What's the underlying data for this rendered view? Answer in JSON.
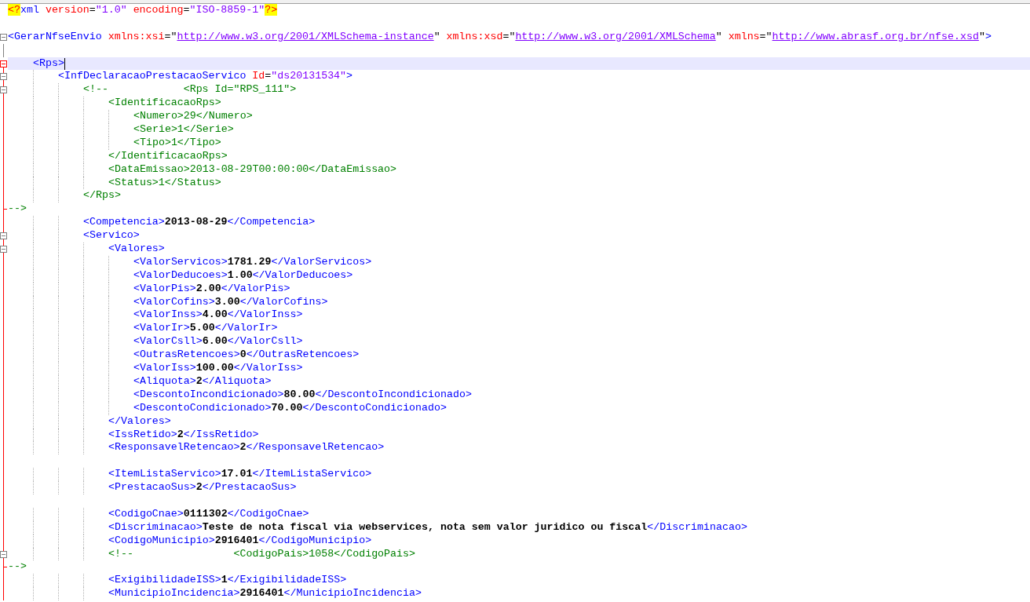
{
  "editor": {
    "lines": [
      {
        "kind": "code",
        "parts": [
          {
            "kind": "decl",
            "text": "<?"
          },
          {
            "kind": "tag",
            "text": "xml"
          },
          {
            "kind": "attr",
            "text": " version"
          },
          {
            "kind": "plain",
            "text": "="
          },
          {
            "kind": "val",
            "text": "\"1.0\""
          },
          {
            "kind": "attr",
            "text": " encoding"
          },
          {
            "kind": "plain",
            "text": "="
          },
          {
            "kind": "val",
            "text": "\"ISO-8859-1\""
          },
          {
            "kind": "decl",
            "text": "?>"
          }
        ]
      },
      {
        "kind": "blank"
      },
      {
        "kind": "code",
        "collapsible": true,
        "parts": [
          {
            "kind": "tag",
            "text": "<GerarNfseEnvio"
          },
          {
            "kind": "attr",
            "text": " xmlns:xsi"
          },
          {
            "kind": "plain",
            "text": "=\""
          },
          {
            "kind": "url",
            "text": "http://www.w3.org/2001/XMLSchema-instance"
          },
          {
            "kind": "plain",
            "text": "\""
          },
          {
            "kind": "attr",
            "text": " xmlns:xsd"
          },
          {
            "kind": "plain",
            "text": "=\""
          },
          {
            "kind": "url",
            "text": "http://www.w3.org/2001/XMLSchema"
          },
          {
            "kind": "plain",
            "text": "\""
          },
          {
            "kind": "attr",
            "text": " xmlns"
          },
          {
            "kind": "plain",
            "text": "=\""
          },
          {
            "kind": "url",
            "text": "http://www.abrasf.org.br/nfse.xsd"
          },
          {
            "kind": "plain",
            "text": "\""
          },
          {
            "kind": "tag",
            "text": ">"
          }
        ]
      },
      {
        "kind": "blank"
      },
      {
        "kind": "code",
        "collapsible": true,
        "current": true,
        "parts": [
          {
            "kind": "tag",
            "text": "    <Rps>"
          }
        ]
      },
      {
        "kind": "code",
        "collapsible": true,
        "parts": [
          {
            "kind": "tag",
            "text": "        <InfDeclaracaoPrestacaoServico"
          },
          {
            "kind": "attr",
            "text": " Id"
          },
          {
            "kind": "plain",
            "text": "="
          },
          {
            "kind": "val",
            "text": "\"ds20131534\""
          },
          {
            "kind": "tag",
            "text": ">"
          }
        ]
      },
      {
        "kind": "code",
        "collapsible": true,
        "parts": [
          {
            "kind": "comment",
            "text": "            <!--            <Rps Id=\"RPS_111\">"
          }
        ]
      },
      {
        "kind": "code",
        "parts": [
          {
            "kind": "comment",
            "text": "                <IdentificacaoRps>"
          }
        ]
      },
      {
        "kind": "code",
        "parts": [
          {
            "kind": "comment",
            "text": "                    <Numero>29</Numero>"
          }
        ]
      },
      {
        "kind": "code",
        "parts": [
          {
            "kind": "comment",
            "text": "                    <Serie>1</Serie>"
          }
        ]
      },
      {
        "kind": "code",
        "parts": [
          {
            "kind": "comment",
            "text": "                    <Tipo>1</Tipo>"
          }
        ]
      },
      {
        "kind": "code",
        "parts": [
          {
            "kind": "comment",
            "text": "                </IdentificacaoRps>"
          }
        ]
      },
      {
        "kind": "code",
        "parts": [
          {
            "kind": "comment",
            "text": "                <DataEmissao>2013-08-29T00:00:00</DataEmissao>"
          }
        ]
      },
      {
        "kind": "code",
        "parts": [
          {
            "kind": "comment",
            "text": "                <Status>1</Status>"
          }
        ]
      },
      {
        "kind": "code",
        "parts": [
          {
            "kind": "comment",
            "text": "            </Rps>"
          }
        ]
      },
      {
        "kind": "code",
        "block_end": true,
        "parts": [
          {
            "kind": "comment",
            "text": "-->"
          }
        ]
      },
      {
        "kind": "code",
        "parts": [
          {
            "kind": "tag",
            "text": "            <Competencia>"
          },
          {
            "kind": "text",
            "text": "2013-08-29"
          },
          {
            "kind": "tag",
            "text": "</Competencia>"
          }
        ]
      },
      {
        "kind": "code",
        "collapsible": true,
        "parts": [
          {
            "kind": "tag",
            "text": "            <Servico>"
          }
        ]
      },
      {
        "kind": "code",
        "collapsible": true,
        "parts": [
          {
            "kind": "tag",
            "text": "                <Valores>"
          }
        ]
      },
      {
        "kind": "code",
        "parts": [
          {
            "kind": "tag",
            "text": "                    <ValorServicos>"
          },
          {
            "kind": "text",
            "text": "1781.29"
          },
          {
            "kind": "tag",
            "text": "</ValorServicos>"
          }
        ]
      },
      {
        "kind": "code",
        "parts": [
          {
            "kind": "tag",
            "text": "                    <ValorDeducoes>"
          },
          {
            "kind": "text",
            "text": "1.00"
          },
          {
            "kind": "tag",
            "text": "</ValorDeducoes>"
          }
        ]
      },
      {
        "kind": "code",
        "parts": [
          {
            "kind": "tag",
            "text": "                    <ValorPis>"
          },
          {
            "kind": "text",
            "text": "2.00"
          },
          {
            "kind": "tag",
            "text": "</ValorPis>"
          }
        ]
      },
      {
        "kind": "code",
        "parts": [
          {
            "kind": "tag",
            "text": "                    <ValorCofins>"
          },
          {
            "kind": "text",
            "text": "3.00"
          },
          {
            "kind": "tag",
            "text": "</ValorCofins>"
          }
        ]
      },
      {
        "kind": "code",
        "parts": [
          {
            "kind": "tag",
            "text": "                    <ValorInss>"
          },
          {
            "kind": "text",
            "text": "4.00"
          },
          {
            "kind": "tag",
            "text": "</ValorInss>"
          }
        ]
      },
      {
        "kind": "code",
        "parts": [
          {
            "kind": "tag",
            "text": "                    <ValorIr>"
          },
          {
            "kind": "text",
            "text": "5.00"
          },
          {
            "kind": "tag",
            "text": "</ValorIr>"
          }
        ]
      },
      {
        "kind": "code",
        "parts": [
          {
            "kind": "tag",
            "text": "                    <ValorCsll>"
          },
          {
            "kind": "text",
            "text": "6.00"
          },
          {
            "kind": "tag",
            "text": "</ValorCsll>"
          }
        ]
      },
      {
        "kind": "code",
        "parts": [
          {
            "kind": "tag",
            "text": "                    <OutrasRetencoes>"
          },
          {
            "kind": "text",
            "text": "0"
          },
          {
            "kind": "tag",
            "text": "</OutrasRetencoes>"
          }
        ]
      },
      {
        "kind": "code",
        "parts": [
          {
            "kind": "tag",
            "text": "                    <ValorIss>"
          },
          {
            "kind": "text",
            "text": "100.00"
          },
          {
            "kind": "tag",
            "text": "</ValorIss>"
          }
        ]
      },
      {
        "kind": "code",
        "parts": [
          {
            "kind": "tag",
            "text": "                    <Aliquota>"
          },
          {
            "kind": "text",
            "text": "2"
          },
          {
            "kind": "tag",
            "text": "</Aliquota>"
          }
        ]
      },
      {
        "kind": "code",
        "parts": [
          {
            "kind": "tag",
            "text": "                    <DescontoIncondicionado>"
          },
          {
            "kind": "text",
            "text": "80.00"
          },
          {
            "kind": "tag",
            "text": "</DescontoIncondicionado>"
          }
        ]
      },
      {
        "kind": "code",
        "parts": [
          {
            "kind": "tag",
            "text": "                    <DescontoCondicionado>"
          },
          {
            "kind": "text",
            "text": "70.00"
          },
          {
            "kind": "tag",
            "text": "</DescontoCondicionado>"
          }
        ]
      },
      {
        "kind": "code",
        "parts": [
          {
            "kind": "tag",
            "text": "                </Valores>"
          }
        ]
      },
      {
        "kind": "code",
        "parts": [
          {
            "kind": "tag",
            "text": "                <IssRetido>"
          },
          {
            "kind": "text",
            "text": "2"
          },
          {
            "kind": "tag",
            "text": "</IssRetido>"
          }
        ]
      },
      {
        "kind": "code",
        "parts": [
          {
            "kind": "tag",
            "text": "                <ResponsavelRetencao>"
          },
          {
            "kind": "text",
            "text": "2"
          },
          {
            "kind": "tag",
            "text": "</ResponsavelRetencao>"
          }
        ]
      },
      {
        "kind": "blank"
      },
      {
        "kind": "code",
        "parts": [
          {
            "kind": "tag",
            "text": "                <ItemListaServico>"
          },
          {
            "kind": "text",
            "text": "17.01"
          },
          {
            "kind": "tag",
            "text": "</ItemListaServico>"
          }
        ]
      },
      {
        "kind": "code",
        "parts": [
          {
            "kind": "tag",
            "text": "                <PrestacaoSus>"
          },
          {
            "kind": "text",
            "text": "2"
          },
          {
            "kind": "tag",
            "text": "</PrestacaoSus>"
          }
        ]
      },
      {
        "kind": "blank"
      },
      {
        "kind": "code",
        "parts": [
          {
            "kind": "tag",
            "text": "                <CodigoCnae>"
          },
          {
            "kind": "text",
            "text": "0111302"
          },
          {
            "kind": "tag",
            "text": "</CodigoCnae>"
          }
        ]
      },
      {
        "kind": "code",
        "parts": [
          {
            "kind": "tag",
            "text": "                <Discriminacao>"
          },
          {
            "kind": "text",
            "text": "Teste de nota fiscal via webservices, nota sem valor juridico ou fiscal"
          },
          {
            "kind": "tag",
            "text": "</Discriminacao>"
          }
        ]
      },
      {
        "kind": "code",
        "parts": [
          {
            "kind": "tag",
            "text": "                <CodigoMunicipio>"
          },
          {
            "kind": "text",
            "text": "2916401"
          },
          {
            "kind": "tag",
            "text": "</CodigoMunicipio>"
          }
        ]
      },
      {
        "kind": "code",
        "collapsible": true,
        "parts": [
          {
            "kind": "comment",
            "text": "                <!--                <CodigoPais>1058</CodigoPais>"
          }
        ]
      },
      {
        "kind": "code",
        "block_end": true,
        "parts": [
          {
            "kind": "comment",
            "text": "-->"
          }
        ]
      },
      {
        "kind": "code",
        "parts": [
          {
            "kind": "tag",
            "text": "                <ExigibilidadeISS>"
          },
          {
            "kind": "text",
            "text": "1"
          },
          {
            "kind": "tag",
            "text": "</ExigibilidadeISS>"
          }
        ]
      },
      {
        "kind": "code",
        "parts": [
          {
            "kind": "tag",
            "text": "                <MunicipioIncidencia>"
          },
          {
            "kind": "text",
            "text": "2916401"
          },
          {
            "kind": "tag",
            "text": "</MunicipioIncidencia>"
          }
        ]
      }
    ]
  }
}
